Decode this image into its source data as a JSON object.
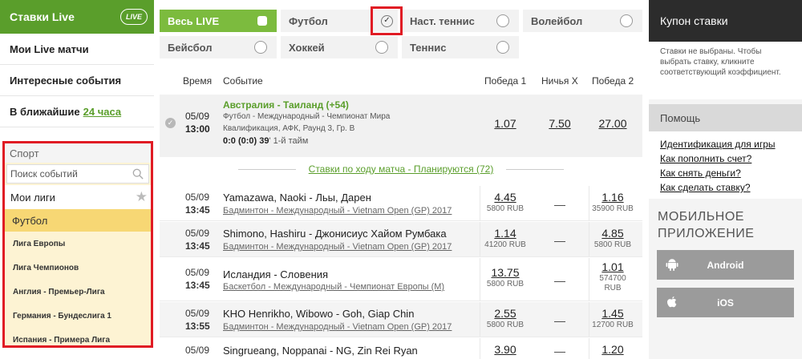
{
  "left": {
    "live_header": "Ставки Live",
    "live_logo": "LIVE",
    "items": [
      {
        "label": "Мои Live матчи"
      },
      {
        "label": "Интересные события"
      },
      {
        "label": "В ближайшие",
        "link": "24 часа"
      }
    ],
    "sport_title": "Спорт",
    "search_placeholder": "Поиск событий",
    "my_leagues": "Мои лиги",
    "football": "Футбол",
    "leagues": [
      "Лига Европы",
      "Лига Чемпионов",
      "Англия - Премьер-Лига",
      "Германия - Бундеслига 1",
      "Испания - Примера Лига"
    ]
  },
  "filters": [
    {
      "label": "Весь LIVE"
    },
    {
      "label": "Футбол"
    },
    {
      "label": "Наст. теннис"
    },
    {
      "label": "Волейбол"
    },
    {
      "label": "Бейсбол"
    },
    {
      "label": "Хоккей"
    },
    {
      "label": "Теннис"
    }
  ],
  "table_head": {
    "time": "Время",
    "event": "Событие",
    "win1": "Победа 1",
    "draw": "Ничья X",
    "win2": "Победа 2"
  },
  "featured": {
    "date": "05/09",
    "time": "13:00",
    "title": "Австралия - Таиланд (+54)",
    "line2": "Футбол - Международный - Чемпионат Мира",
    "line3": "Квалификация, АФК, Раунд 3, Гр. B",
    "score": "0:0 (0:0) 39",
    "half": "' 1-й тайм",
    "win1": "1.07",
    "draw": "7.50",
    "win2": "27.00"
  },
  "planned": "Ставки по ходу матча - Планируются (72)",
  "rows": [
    {
      "date": "05/09",
      "time": "13:45",
      "teams": "Yamazawa, Naoki - Льы, Дарен",
      "sub": "Бадминтон - Международный - Vietnam Open (GP) 2017",
      "w1": "4.45",
      "w1s": "5800 RUB",
      "draw": "—",
      "w2": "1.16",
      "w2s": "35900 RUB"
    },
    {
      "date": "05/09",
      "time": "13:45",
      "teams": "Shimono, Hashiru - Джонисиус Хайом Румбака",
      "sub": "Бадминтон - Международный - Vietnam Open (GP) 2017",
      "w1": "1.14",
      "w1s": "41200 RUB",
      "draw": "—",
      "w2": "4.85",
      "w2s": "5800 RUB"
    },
    {
      "date": "05/09",
      "time": "13:45",
      "teams": "Исландия - Словения",
      "sub": "Баскетбол - Международный - Чемпионат Европы (М)",
      "w1": "13.75",
      "w1s": "5800 RUB",
      "draw": "—",
      "w2": "1.01",
      "w2s": "574700",
      "w2s2": "RUB"
    },
    {
      "date": "05/09",
      "time": "13:55",
      "teams": "KHO Henrikho, Wibowo - Goh, Giap Chin",
      "sub": "Бадминтон - Международный - Vietnam Open (GP) 2017",
      "w1": "2.55",
      "w1s": "5800 RUB",
      "draw": "—",
      "w2": "1.45",
      "w2s": "12700 RUB"
    },
    {
      "date": "05/09",
      "time": "",
      "teams": "Singrueang, Noppanai - NG, Zin Rei Ryan",
      "sub": "",
      "w1": "3.90",
      "w1s": "",
      "draw": "—",
      "w2": "1.20",
      "w2s": ""
    }
  ],
  "right": {
    "coupon_head": "Купон ставки",
    "coupon_text": "Ставки не выбраны. Чтобы выбрать ставку, кликните соответствующий коэффициент.",
    "help_head": "Помощь",
    "help_links": [
      "Идентификация для игры",
      "Как пополнить счет?",
      "Как снять деньги?",
      "Как сделать ставку?"
    ],
    "mobile_title_1": "МОБИЛЬНОЕ",
    "mobile_title_2": "ПРИЛОЖЕНИЕ",
    "android": "Android",
    "ios": "iOS"
  },
  "colors": {
    "brand_green": "#5a9e2b",
    "active_filter": "#7cbb3e",
    "highlight_red": "#e01b24",
    "football_yellow": "#f7d774"
  }
}
